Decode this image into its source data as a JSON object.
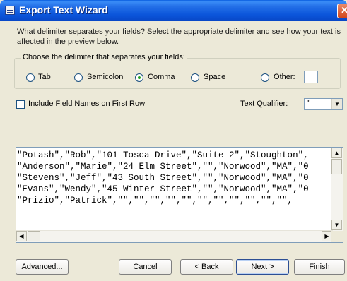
{
  "window": {
    "title": "Export Text Wizard",
    "close_glyph": "✕",
    "icon": "app-form-icon"
  },
  "prompt": "What delimiter separates your fields? Select the appropriate delimiter and see how your text is affected in the preview below.",
  "delimiter_group": {
    "label": "Choose the delimiter that separates your fields:",
    "selected": "Comma",
    "options": [
      {
        "pre": "",
        "key": "T",
        "post": "ab"
      },
      {
        "pre": "",
        "key": "S",
        "post": "emicolon"
      },
      {
        "pre": "",
        "key": "C",
        "post": "omma"
      },
      {
        "pre": "S",
        "key": "p",
        "post": "ace"
      },
      {
        "pre": "",
        "key": "O",
        "post": "ther:"
      }
    ],
    "other_value": ""
  },
  "field_names": {
    "checked": false,
    "key": "I",
    "rest": "nclude Field Names on First Row"
  },
  "text_qualifier": {
    "label_pre": "Text ",
    "label_key": "Q",
    "label_post": "ualifier:",
    "value": "\""
  },
  "preview_lines": [
    "\"Potash\",\"Rob\",\"101 Tosca Drive\",\"Suite 2\",\"Stoughton\",",
    "\"Anderson\",\"Marie\",\"24 Elm Street\",\"\",\"Norwood\",\"MA\",\"0",
    "\"Stevens\",\"Jeff\",\"43 South Street\",\"\",\"Norwood\",\"MA\",\"0",
    "\"Evans\",\"Wendy\",\"45 Winter Street\",\"\",\"Norwood\",\"MA\",\"0",
    "\"Prizio\",\"Patrick\",\"\",\"\",\"\",\"\",\"\",\"\",\"\",\"\",\"\",\"\",\"\","
  ],
  "scroll_glyphs": {
    "up": "▲",
    "down": "▼",
    "left": "◀",
    "right": "▶"
  },
  "dropdown_glyph": "▼",
  "buttons": {
    "advanced": {
      "pre": "Ad",
      "key": "v",
      "post": "anced..."
    },
    "cancel": "Cancel",
    "back": {
      "pre": "< ",
      "key": "B",
      "post": "ack"
    },
    "next": {
      "pre": "",
      "key": "N",
      "post": "ext >"
    },
    "finish": {
      "pre": "",
      "key": "F",
      "post": "inish"
    }
  }
}
